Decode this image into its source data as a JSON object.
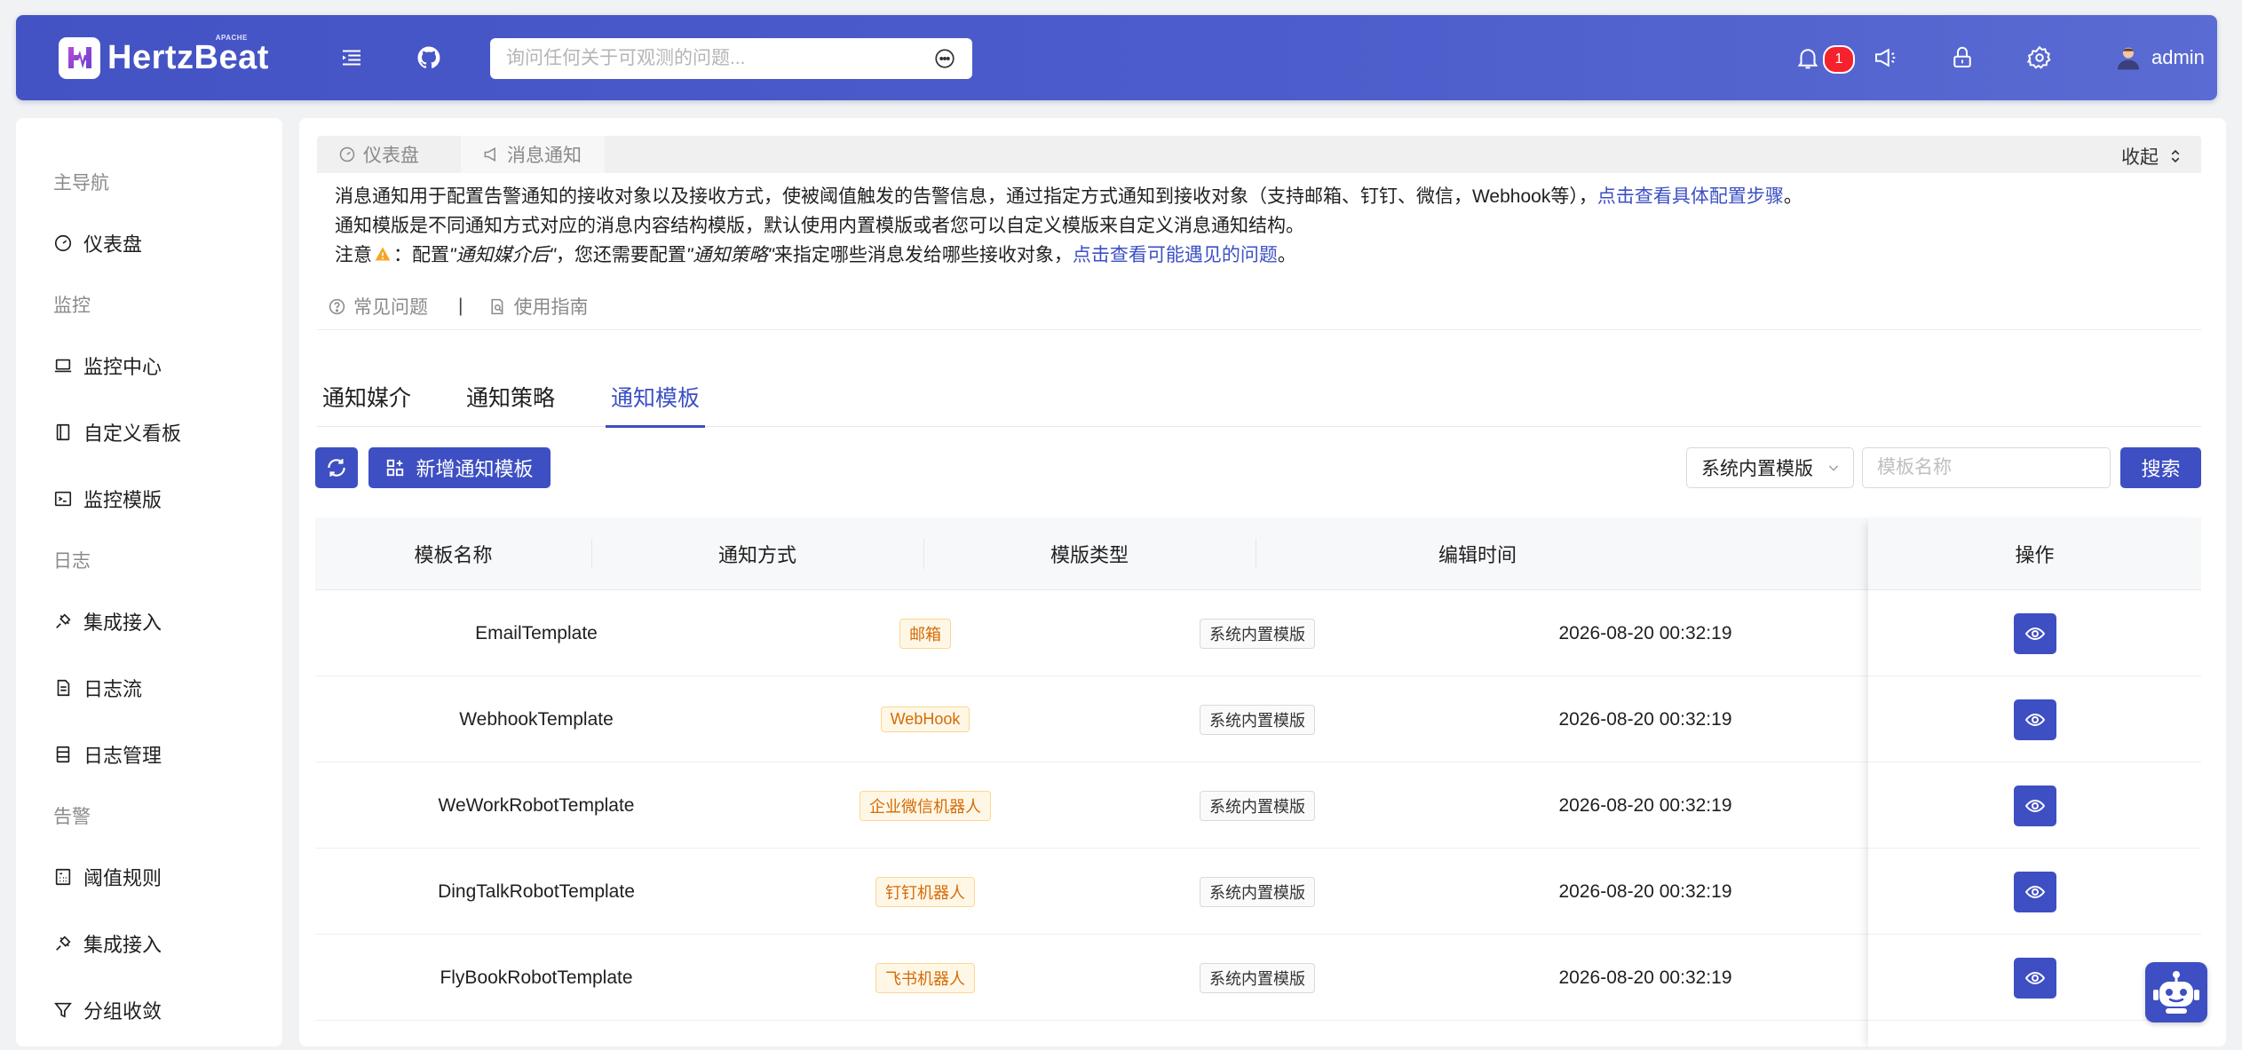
{
  "header": {
    "logo_text": "HertzBeat",
    "logo_tag": "APACHE",
    "search_placeholder": "询问任何关于可观测的问题...",
    "notification_count": "1",
    "username": "admin"
  },
  "sidebar": {
    "groups": {
      "main": "主导航",
      "monitor": "监控",
      "log": "日志",
      "alert": "告警"
    },
    "items": {
      "dashboard": "仪表盘",
      "monitor_center": "监控中心",
      "custom_board": "自定义看板",
      "monitor_template": "监控模版",
      "log_integration": "集成接入",
      "log_stream": "日志流",
      "log_manage": "日志管理",
      "threshold_rules": "阈值规则",
      "alert_integration": "集成接入",
      "group_converge": "分组收敛"
    }
  },
  "notice": {
    "tabs": [
      "仪表盘",
      "消息通知"
    ],
    "collapse_label": "收起",
    "line1_text": "消息通知用于配置告警通知的接收对象以及接收方式，使被阈值触发的告警信息，通过指定方式通知到接收对象（支持邮箱、钉钉、微信，Webhook等），",
    "line1_link": "点击查看具体配置步骤",
    "line1_end": "。",
    "line2_text": "通知模版是不同通知方式对应的消息内容结构模版，默认使用内置模版或者您可以自定义模版来自定义消息通知结构。",
    "line3_prefix": "注意",
    "line3_colon": "：配置",
    "line3_media": "\"通知媒介后\"",
    "line3_mid": "，您还需要配置",
    "line3_policy": "\"通知策略\"",
    "line3_rest": "来指定哪些消息发给哪些接收对象，",
    "line3_link": "点击查看可能遇见的问题",
    "line3_end": "。",
    "faq": "常见问题",
    "separator": "|",
    "guide": "使用指南"
  },
  "subtabs": {
    "media": "通知媒介",
    "policy": "通知策略",
    "template": "通知模板"
  },
  "toolbar": {
    "add_label": "新增通知模板",
    "type_select_value": "系统内置模版",
    "name_placeholder": "模板名称",
    "search_label": "搜索"
  },
  "table": {
    "columns": [
      "模板名称",
      "通知方式",
      "模版类型",
      "编辑时间",
      "操作"
    ],
    "rows": [
      {
        "name": "EmailTemplate",
        "method": "邮箱",
        "type": "系统内置模版",
        "time": "2026-08-20 00:32:19"
      },
      {
        "name": "WebhookTemplate",
        "method": "WebHook",
        "type": "系统内置模版",
        "time": "2026-08-20 00:32:19"
      },
      {
        "name": "WeWorkRobotTemplate",
        "method": "企业微信机器人",
        "type": "系统内置模版",
        "time": "2026-08-20 00:32:19"
      },
      {
        "name": "DingTalkRobotTemplate",
        "method": "钉钉机器人",
        "type": "系统内置模版",
        "time": "2026-08-20 00:32:19"
      },
      {
        "name": "FlyBookRobotTemplate",
        "method": "飞书机器人",
        "type": "系统内置模版",
        "time": "2026-08-20 00:32:19"
      }
    ]
  },
  "colors": {
    "primary": "#3d4fc2",
    "tag_orange": "#d46b08",
    "badge_red": "#f5222d"
  }
}
